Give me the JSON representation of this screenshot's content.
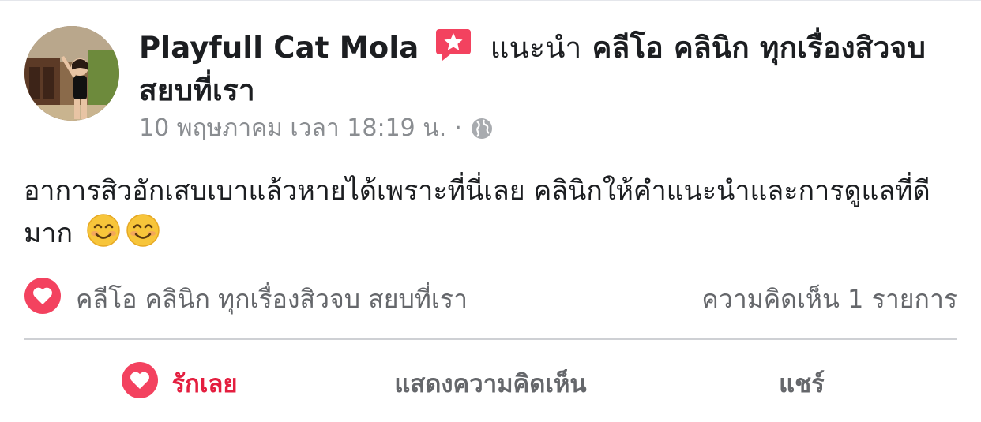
{
  "post": {
    "author_name": "Playfull Cat Mola",
    "recommend_verb": "แนะนำ",
    "page_name": "คลีโอ คลินิก ทุกเรื่องสิวจบ สยบที่เรา",
    "date": "10 พฤษภาคม เวลา 18:19 น.",
    "dot": "·",
    "privacy_icon": "globe-icon",
    "body": "อาการสิวอักเสบเบาแล้วหายได้เพราะที่นี่เลย คลินิกให้คำแนะนำและการดูแลที่ดีมาก",
    "emojis": [
      "smiling-face-icon",
      "smiling-face-icon"
    ]
  },
  "reactions": {
    "reactor": "คลีโอ คลินิก ทุกเรื่องสิวจบ สยบที่เรา",
    "comments_count": "ความคิดเห็น 1 รายการ"
  },
  "actions": {
    "love": "รักเลย",
    "comment": "แสดงความคิดเห็น",
    "share": "แชร์"
  },
  "colors": {
    "love_red": "#e41e3f",
    "recommend_pink": "#f3425f",
    "meta_gray": "#8a8d91",
    "action_gray": "#65676b"
  }
}
